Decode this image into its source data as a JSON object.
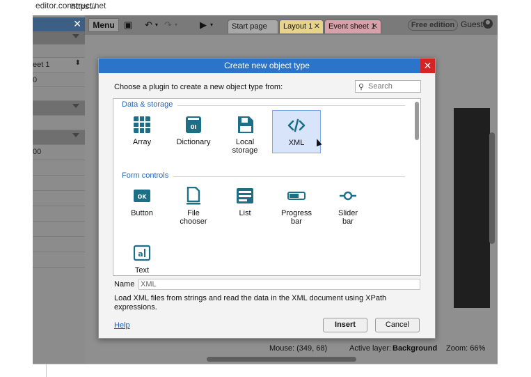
{
  "browser": {
    "url_scheme": "https://",
    "url_rest": "editor.construct.net"
  },
  "left_panel": {
    "rows": [
      {
        "label": "",
        "type": "section"
      },
      {
        "label": "",
        "type": "row"
      },
      {
        "label": "eet 1",
        "type": "row"
      },
      {
        "label": "0",
        "type": "row"
      },
      {
        "label": "",
        "type": "section"
      },
      {
        "label": "",
        "type": "row"
      },
      {
        "label": "",
        "type": "section"
      },
      {
        "label": "00",
        "type": "row"
      }
    ]
  },
  "toolbar": {
    "menu_label": "Menu",
    "tabs": [
      {
        "label": "Start page"
      },
      {
        "label": "Layout 1"
      },
      {
        "label": "Event sheet 1"
      }
    ],
    "free_edition": "Free edition",
    "user": "Guest"
  },
  "status": {
    "mouse": "Mouse: (349, 68)",
    "active_layer_label": "Active layer:",
    "active_layer_value": "Background",
    "zoom": "Zoom: 66%"
  },
  "dialog": {
    "title": "Create new object type",
    "prompt": "Choose a plugin to create a new object type from:",
    "search_placeholder": "Search",
    "categories": [
      {
        "name": "Data & storage",
        "plugins": [
          {
            "label": "Array",
            "icon": "grid-icon"
          },
          {
            "label": "Dictionary",
            "icon": "dictionary-icon"
          },
          {
            "label": "Local storage",
            "label_lines": [
              "Local",
              "storage"
            ],
            "icon": "floppy-icon"
          },
          {
            "label": "XML",
            "icon": "code-icon",
            "selected": true
          }
        ]
      },
      {
        "name": "Form controls",
        "plugins": [
          {
            "label": "Button",
            "icon": "ok-button-icon"
          },
          {
            "label": "File chooser",
            "label_lines": [
              "File",
              "chooser"
            ],
            "icon": "file-icon"
          },
          {
            "label": "List",
            "icon": "list-icon"
          },
          {
            "label": "Progress bar",
            "label_lines": [
              "Progress",
              "bar"
            ],
            "icon": "progress-bar-icon"
          },
          {
            "label": "Slider bar",
            "label_lines": [
              "Slider",
              "bar"
            ],
            "icon": "slider-icon"
          },
          {
            "label": "Text",
            "label_lines": [
              "Text"
            ],
            "icon": "text-input-icon"
          }
        ]
      }
    ],
    "name_label": "Name",
    "name_value": "XML",
    "description": "Load XML files from strings and read the data in the XML document using XPath expressions.",
    "help_label": "Help",
    "insert_label": "Insert",
    "cancel_label": "Cancel"
  },
  "colors": {
    "accent": "#2b74c9",
    "icon": "#1d6f86",
    "close": "#d42424"
  }
}
